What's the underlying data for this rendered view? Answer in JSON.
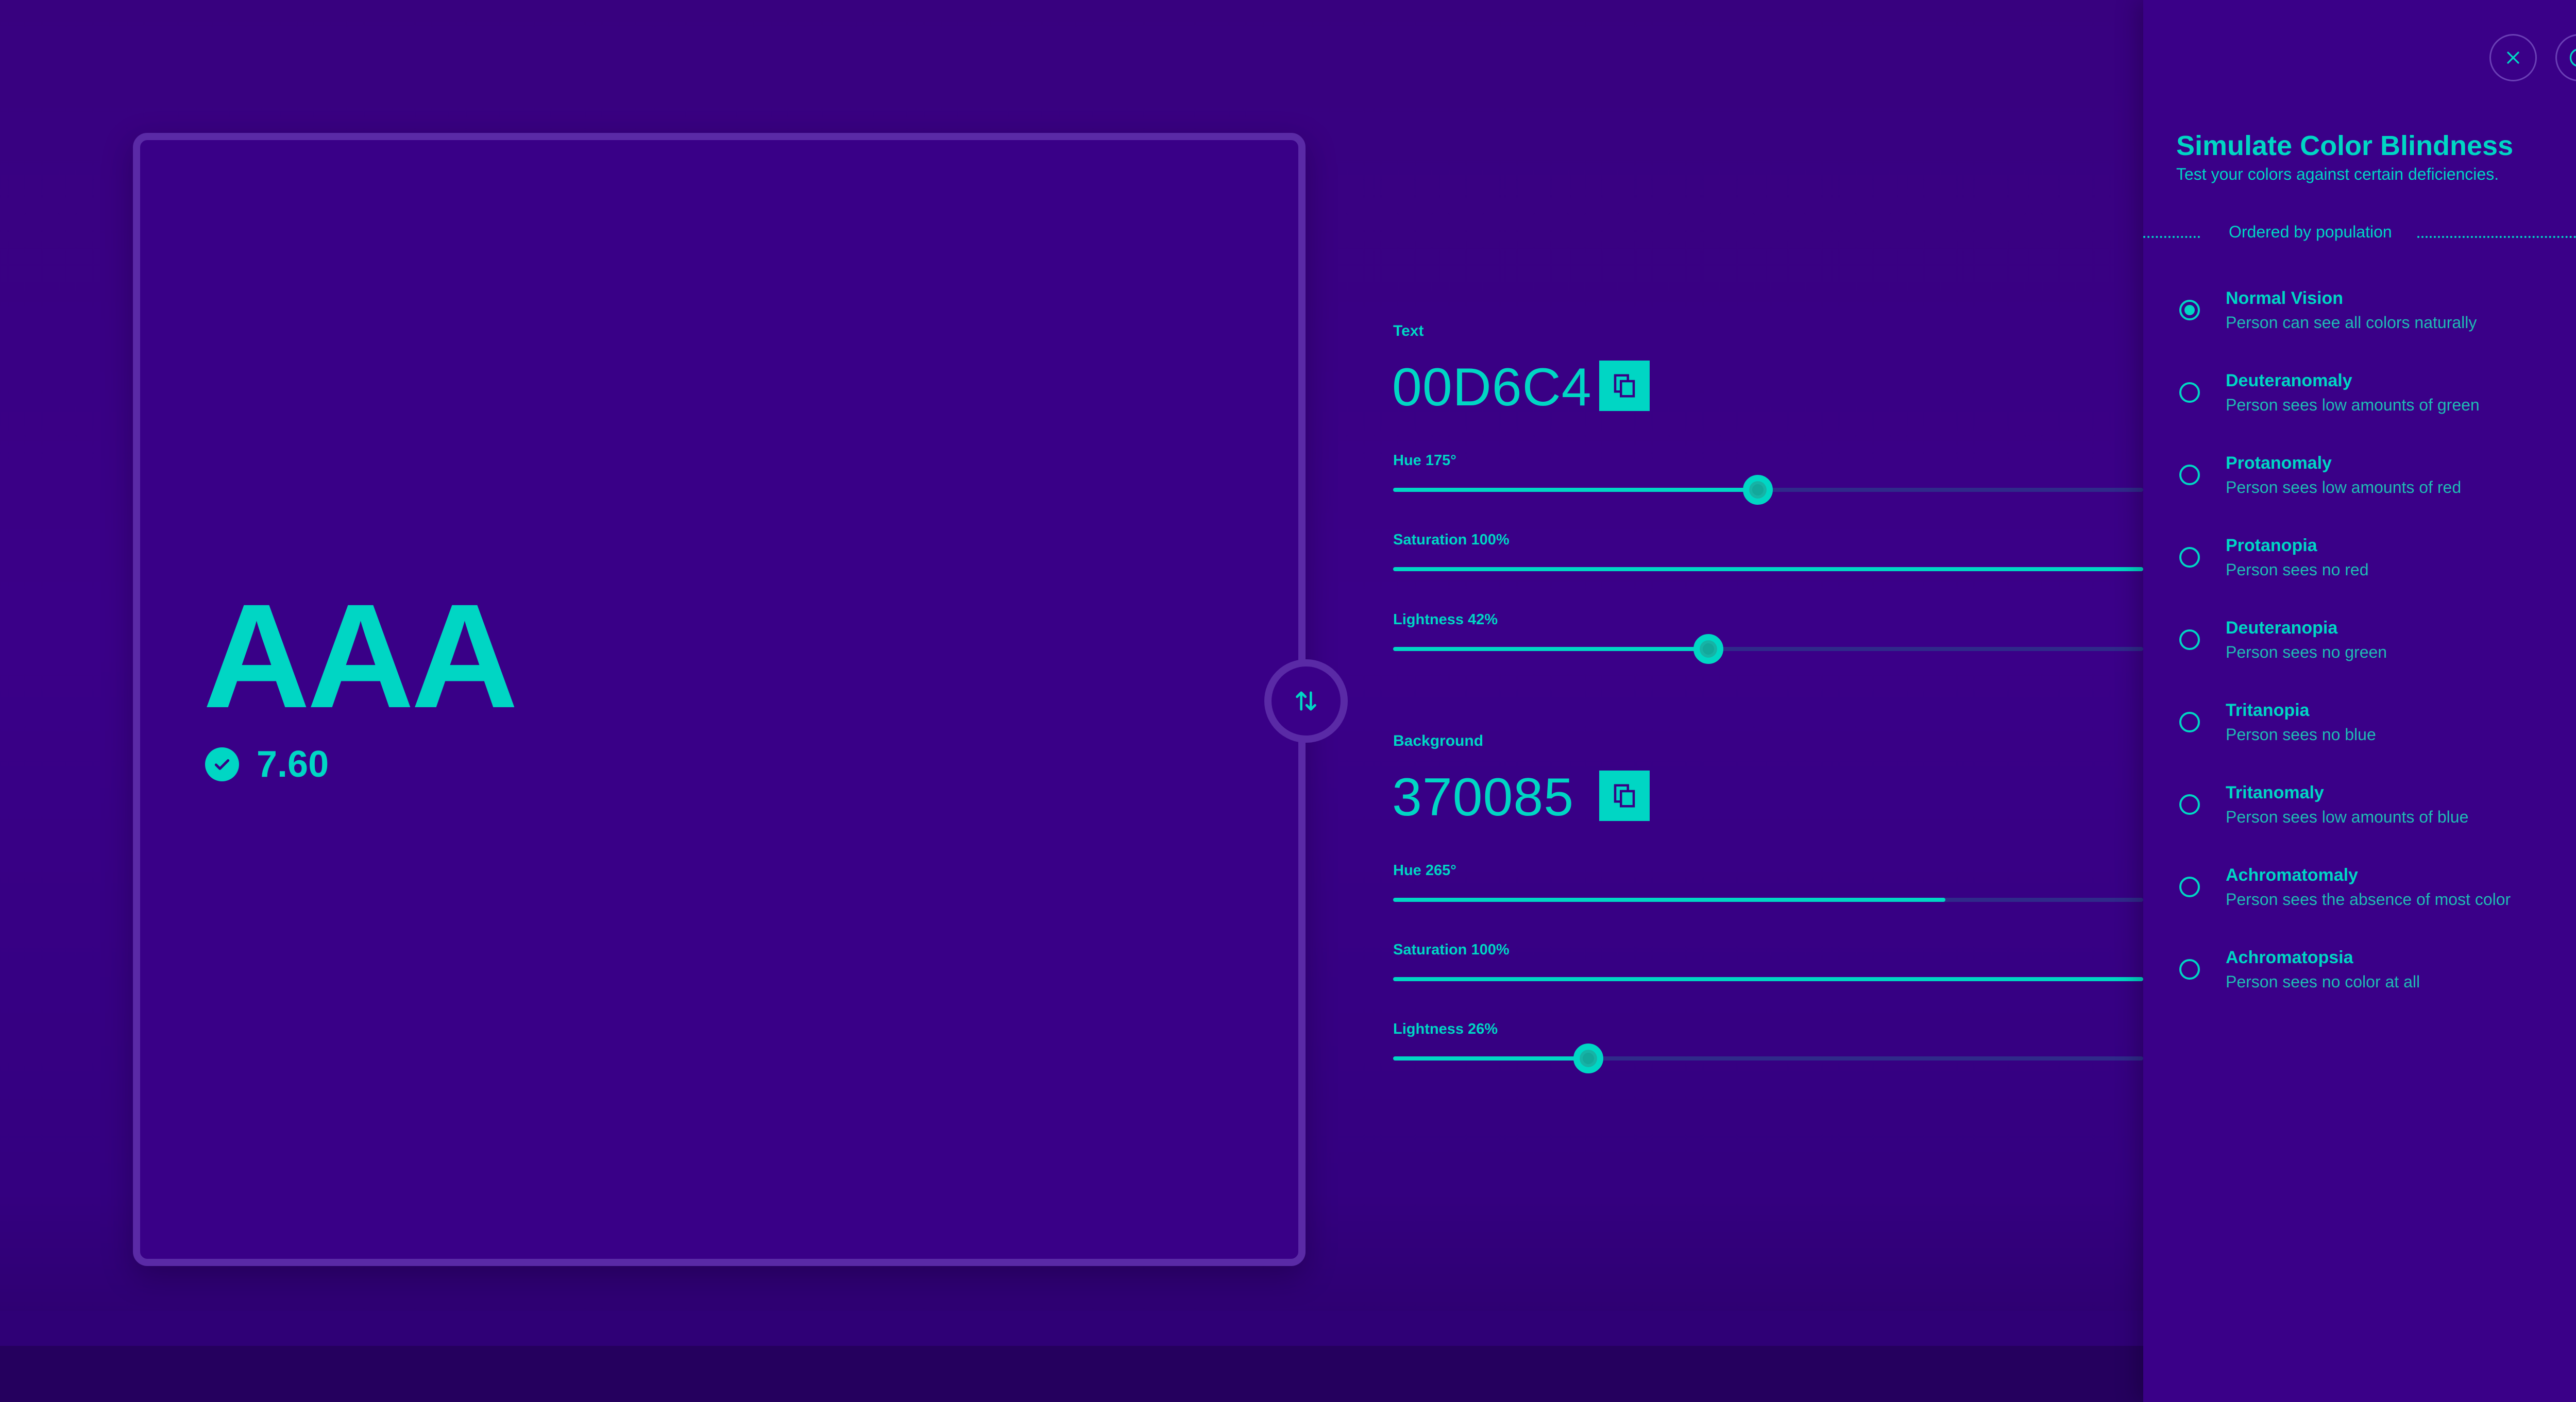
{
  "preview": {
    "sample_text": "AAA",
    "contrast_ratio": "7.60"
  },
  "text_color": {
    "label": "Text",
    "hex": "00D6C4",
    "hue_label": "Hue 175°",
    "saturation_label": "Saturation 100%",
    "lightness_label": "Lightness 42%",
    "hue_fraction": 0.486,
    "saturation_fraction": 1.0,
    "lightness_fraction": 0.42
  },
  "background_color": {
    "label": "Background",
    "hex": "370085",
    "hue_label": "Hue 265°",
    "saturation_label": "Saturation 100%",
    "lightness_label": "Lightness 26%",
    "hue_fraction": 0.736,
    "saturation_fraction": 1.0,
    "lightness_fraction": 0.26
  },
  "panel": {
    "title": "Simulate Color Blindness",
    "subtitle": "Test your colors against certain deficiencies.",
    "divider": "Ordered by population",
    "options": [
      {
        "title": "Normal Vision",
        "desc": "Person can see all colors naturally",
        "checked": true
      },
      {
        "title": "Deuteranomaly",
        "desc": "Person sees low amounts of green",
        "checked": false
      },
      {
        "title": "Protanomaly",
        "desc": "Person sees low amounts of red",
        "checked": false
      },
      {
        "title": "Protanopia",
        "desc": "Person sees no red",
        "checked": false
      },
      {
        "title": "Deuteranopia",
        "desc": "Person sees no green",
        "checked": false
      },
      {
        "title": "Tritanopia",
        "desc": "Person sees no blue",
        "checked": false
      },
      {
        "title": "Tritanomaly",
        "desc": "Person sees low amounts of blue",
        "checked": false
      },
      {
        "title": "Achromatomaly",
        "desc": "Person sees the absence of most color",
        "checked": false
      },
      {
        "title": "Achromatopsia",
        "desc": "Person sees no color at all",
        "checked": false
      }
    ]
  },
  "icons": {
    "close": "close-icon",
    "info": "alert-circle-icon",
    "copy": "copy-icon",
    "swap": "swap-vertical-icon",
    "check": "check-circle-icon"
  },
  "colors": {
    "accent": "#00D6C4",
    "background": "#370085"
  }
}
